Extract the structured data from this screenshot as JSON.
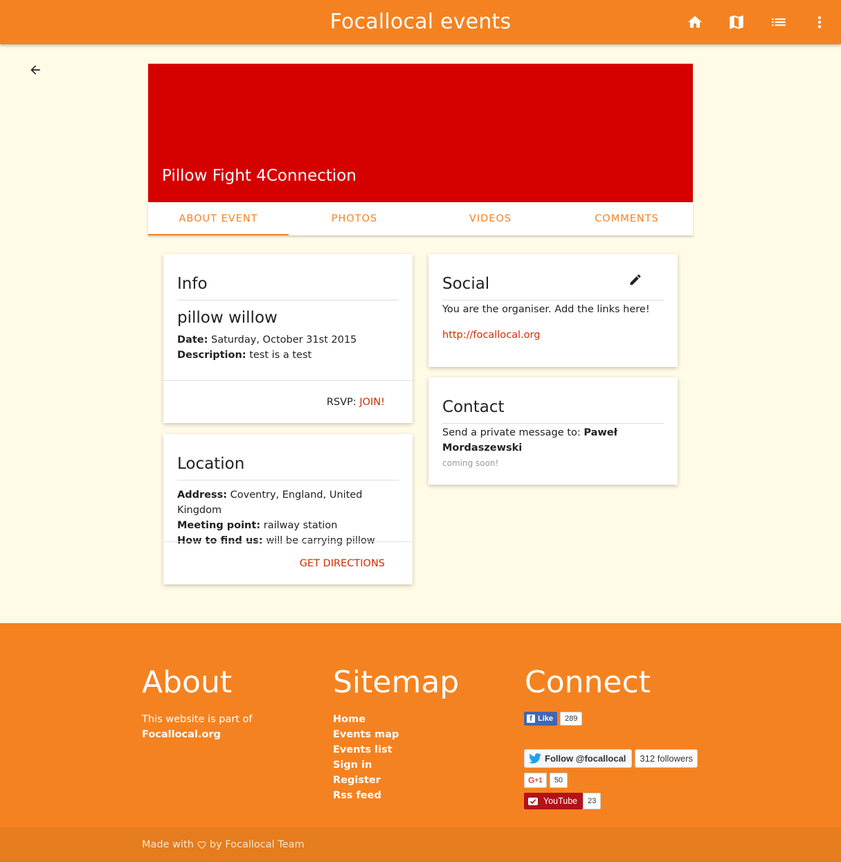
{
  "app": {
    "title": "Focallocal events"
  },
  "toolbar": {
    "icons": [
      "home-icon",
      "map-icon",
      "list-icon",
      "more-vert-icon"
    ]
  },
  "event": {
    "title": "Pillow Fight 4Connection",
    "hero_color": "#d50000"
  },
  "tabs": [
    {
      "label": "ABOUT EVENT",
      "active": true
    },
    {
      "label": "PHOTOS",
      "active": false
    },
    {
      "label": "VIDEOS",
      "active": false
    },
    {
      "label": "COMMENTS",
      "active": false
    }
  ],
  "info": {
    "heading": "Info",
    "name": "pillow willow",
    "date_label": "Date:",
    "date": "Saturday, October 31st 2015",
    "description_label": "Description:",
    "description": "test is a test",
    "rsvp_label": "RSVP:",
    "rsvp_action": "JOIN!"
  },
  "location": {
    "heading": "Location",
    "address_label": "Address:",
    "address": "Coventry, England, United Kingdom",
    "meeting_label": "Meeting point:",
    "meeting": "railway station",
    "find_label": "How to find us:",
    "find": "will be carrying pillow",
    "action": "GET DIRECTIONS"
  },
  "social": {
    "heading": "Social",
    "text": "You are the organiser. Add the links here!",
    "link": "http://focallocal.org"
  },
  "contact": {
    "heading": "Contact",
    "text": "Send a private message to:",
    "name_line1": "Paweł",
    "name_line2": "Mordaszewski",
    "note": "coming soon!"
  },
  "footer": {
    "about": {
      "heading": "About",
      "text": "This website is part of",
      "link": "Focallocal.org"
    },
    "sitemap": {
      "heading": "Sitemap",
      "links": [
        "Home",
        "Events map",
        "Events list",
        "Sign in",
        "Register",
        "Rss feed"
      ]
    },
    "connect": {
      "heading": "Connect",
      "fb_label": "Like",
      "fb_count": "289",
      "twitter_label": "Follow @focallocal",
      "twitter_count": "312 followers",
      "gplus_label": "+1",
      "gplus_count": "50",
      "youtube_label": "YouTube",
      "youtube_count": "23"
    },
    "made_with": "Made with",
    "by": "by Focallocal Team"
  },
  "colors": {
    "primary": "#f58220",
    "accent": "#d52b00",
    "background": "#fffbe6"
  }
}
